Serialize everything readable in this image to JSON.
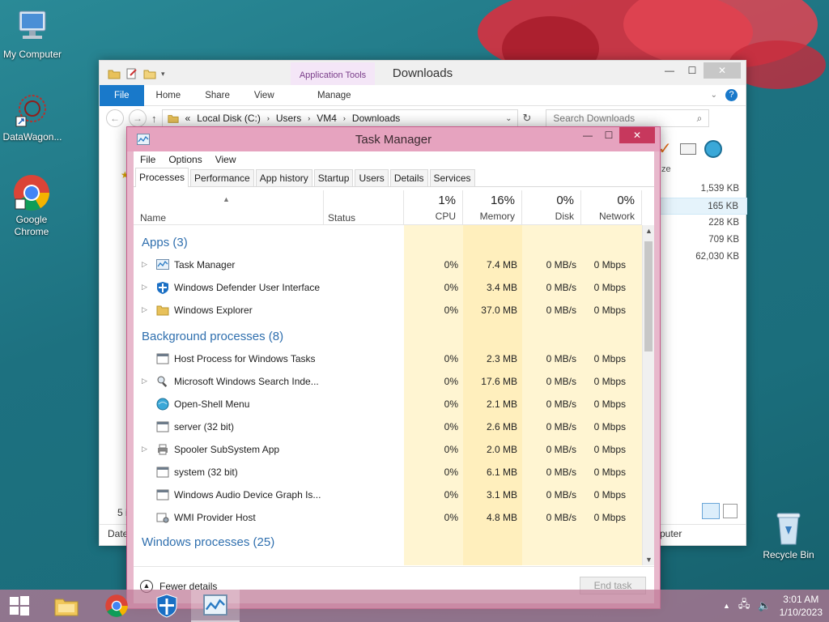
{
  "desktop": {
    "icons": [
      {
        "label": "My Computer"
      },
      {
        "label": "DataWagon..."
      },
      {
        "label": "Google Chrome"
      },
      {
        "label": "Recycle Bin"
      }
    ]
  },
  "explorer": {
    "title": "Downloads",
    "app_tools": "Application Tools",
    "tabs": [
      "File",
      "Home",
      "Share",
      "View",
      "Manage"
    ],
    "address": {
      "prefix": "«",
      "crumbs": [
        "Local Disk (C:)",
        "Users",
        "VM4",
        "Downloads"
      ]
    },
    "search_placeholder": "Search Downloads",
    "size_header": "ze",
    "sizes": [
      "1,539 KB",
      "165 KB",
      "228 KB",
      "709 KB",
      "62,030 KB"
    ],
    "status_left": "5 i",
    "status_date": "Date",
    "status_right": "puter"
  },
  "taskmanager": {
    "title": "Task Manager",
    "menu": [
      "File",
      "Options",
      "View"
    ],
    "tabs": [
      "Processes",
      "Performance",
      "App history",
      "Startup",
      "Users",
      "Details",
      "Services"
    ],
    "active_tab": "Processes",
    "headers": {
      "name": "Name",
      "status": "Status",
      "cpu": {
        "pct": "1%",
        "label": "CPU"
      },
      "memory": {
        "pct": "16%",
        "label": "Memory"
      },
      "disk": {
        "pct": "0%",
        "label": "Disk"
      },
      "network": {
        "pct": "0%",
        "label": "Network"
      }
    },
    "groups": [
      {
        "label": "Apps (3)"
      },
      {
        "label": "Background processes (8)"
      },
      {
        "label": "Windows processes (25)"
      }
    ],
    "apps": [
      {
        "name": "Task Manager",
        "cpu": "0%",
        "mem": "7.4 MB",
        "disk": "0 MB/s",
        "net": "0 Mbps"
      },
      {
        "name": "Windows Defender User Interface",
        "cpu": "0%",
        "mem": "3.4 MB",
        "disk": "0 MB/s",
        "net": "0 Mbps"
      },
      {
        "name": "Windows Explorer",
        "cpu": "0%",
        "mem": "37.0 MB",
        "disk": "0 MB/s",
        "net": "0 Mbps"
      }
    ],
    "background": [
      {
        "name": "Host Process for Windows Tasks",
        "cpu": "0%",
        "mem": "2.3 MB",
        "disk": "0 MB/s",
        "net": "0 Mbps"
      },
      {
        "name": "Microsoft Windows Search Inde...",
        "cpu": "0%",
        "mem": "17.6 MB",
        "disk": "0 MB/s",
        "net": "0 Mbps"
      },
      {
        "name": "Open-Shell Menu",
        "cpu": "0%",
        "mem": "2.1 MB",
        "disk": "0 MB/s",
        "net": "0 Mbps"
      },
      {
        "name": "server (32 bit)",
        "cpu": "0%",
        "mem": "2.6 MB",
        "disk": "0 MB/s",
        "net": "0 Mbps"
      },
      {
        "name": "Spooler SubSystem App",
        "cpu": "0%",
        "mem": "2.0 MB",
        "disk": "0 MB/s",
        "net": "0 Mbps"
      },
      {
        "name": "system (32 bit)",
        "cpu": "0%",
        "mem": "6.1 MB",
        "disk": "0 MB/s",
        "net": "0 Mbps"
      },
      {
        "name": "Windows Audio Device Graph Is...",
        "cpu": "0%",
        "mem": "3.1 MB",
        "disk": "0 MB/s",
        "net": "0 Mbps"
      },
      {
        "name": "WMI Provider Host",
        "cpu": "0%",
        "mem": "4.8 MB",
        "disk": "0 MB/s",
        "net": "0 Mbps"
      }
    ],
    "fewer_details": "Fewer details",
    "end_task": "End task"
  },
  "taskbar": {
    "time": "3:01 AM",
    "date": "1/10/2023"
  }
}
